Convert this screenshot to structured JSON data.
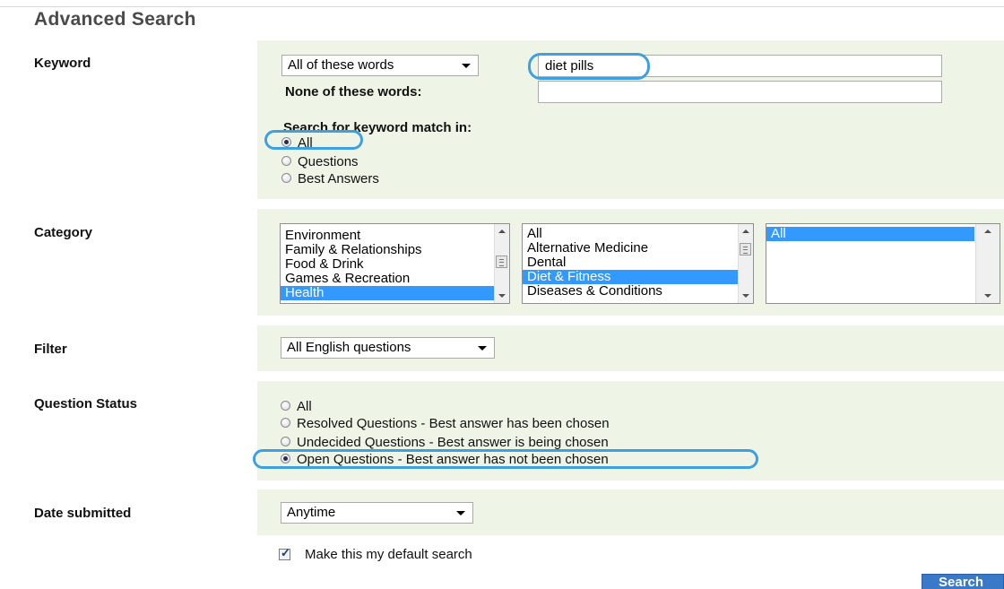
{
  "page": {
    "title": "Advanced Search"
  },
  "keyword": {
    "label": "Keyword",
    "match_mode": {
      "selected": "All of these words"
    },
    "all_words_value": "diet pills",
    "none_label": "None of these words:",
    "none_value": "",
    "match_in_label": "Search for keyword match in:",
    "match_in_options": [
      {
        "label": "All",
        "checked": true
      },
      {
        "label": "Questions",
        "checked": false
      },
      {
        "label": "Best Answers",
        "checked": false
      }
    ]
  },
  "category": {
    "label": "Category",
    "list1": [
      "Environment",
      "Family & Relationships",
      "Food & Drink",
      "Games & Recreation",
      "Health"
    ],
    "list1_selected": "Health",
    "list2": [
      "All",
      "Alternative Medicine",
      "Dental",
      "Diet & Fitness",
      "Diseases & Conditions"
    ],
    "list2_selected": "Diet & Fitness",
    "list3": [
      "All"
    ],
    "list3_selected": "All"
  },
  "filter": {
    "label": "Filter",
    "selected": "All English questions"
  },
  "question_status": {
    "label": "Question Status",
    "options": [
      {
        "label": "All",
        "checked": false
      },
      {
        "label": "Resolved Questions - Best answer has been chosen",
        "checked": false
      },
      {
        "label": "Undecided Questions - Best answer is being chosen",
        "checked": false
      },
      {
        "label": "Open Questions - Best answer has not been chosen",
        "checked": true
      }
    ]
  },
  "date_submitted": {
    "label": "Date submitted",
    "selected": "Anytime"
  },
  "default_search": {
    "label": "Make this my default search",
    "checked": true
  },
  "search_button": {
    "label": "Search"
  },
  "colors": {
    "panel_bg": "#eef5e7",
    "highlight": "#3fa0e0",
    "selection": "#3399ff",
    "button": "#3a78c8"
  }
}
